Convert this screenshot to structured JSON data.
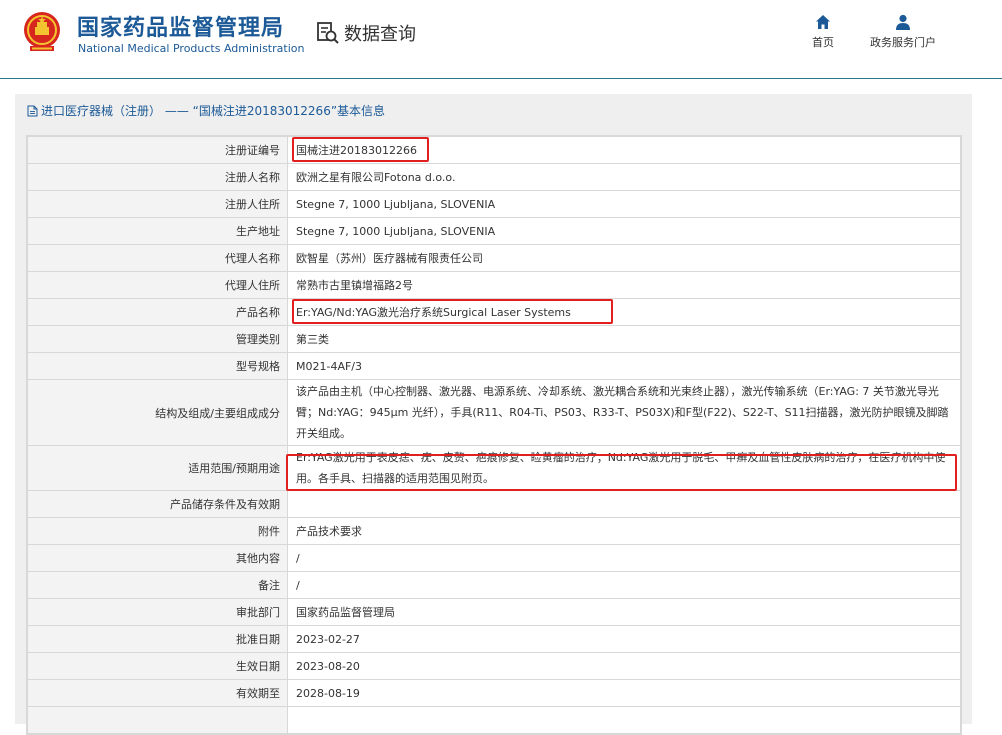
{
  "header": {
    "org_name_cn": "国家药品监督管理局",
    "org_name_en": "National Medical Products Administration",
    "search_label": "数据查询",
    "nav": [
      {
        "label": "首页",
        "icon": "home-icon"
      },
      {
        "label": "政务服务门户",
        "icon": "user-icon"
      }
    ]
  },
  "breadcrumb": "进口医疗器械（注册） —— “国械注进20183012266”基本信息",
  "rows": [
    {
      "label": "注册证编号",
      "value": "国械注进20183012266"
    },
    {
      "label": "注册人名称",
      "value": "欧洲之星有限公司Fotona d.o.o."
    },
    {
      "label": "注册人住所",
      "value": "Stegne 7, 1000 Ljubljana, SLOVENIA"
    },
    {
      "label": "生产地址",
      "value": "Stegne 7, 1000 Ljubljana, SLOVENIA"
    },
    {
      "label": "代理人名称",
      "value": "欧智星（苏州）医疗器械有限责任公司"
    },
    {
      "label": "代理人住所",
      "value": "常熟市古里镇增福路2号"
    },
    {
      "label": "产品名称",
      "value": "Er:YAG/Nd:YAG激光治疗系统Surgical Laser Systems"
    },
    {
      "label": "管理类别",
      "value": "第三类"
    },
    {
      "label": "型号规格",
      "value": "M021-4AF/3"
    },
    {
      "label": "结构及组成/主要组成成分",
      "value": "该产品由主机（中心控制器、激光器、电源系统、冷却系统、激光耦合系统和光束终止器），激光传输系统（Er:YAG: 7 关节激光导光臂；Nd:YAG：945μm 光纤），手具(R11、R04-Ti、PS03、R33-T、PS03X)和F型(F22)、S22-T、S11扫描器，激光防护眼镜及脚踏开关组成。"
    },
    {
      "label": "适用范围/预期用途",
      "value": "Er:YAG激光用于表皮痣、疣、皮赘、疤痕修复、睑黄瘤的治疗；Nd:YAG激光用于脱毛、甲癣及血管性皮肤病的治疗，在医疗机构中使用。各手具、扫描器的适用范围见附页。"
    },
    {
      "label": "产品储存条件及有效期",
      "value": ""
    },
    {
      "label": "附件",
      "value": "产品技术要求"
    },
    {
      "label": "其他内容",
      "value": "/"
    },
    {
      "label": "备注",
      "value": "/"
    },
    {
      "label": "审批部门",
      "value": "国家药品监督管理局"
    },
    {
      "label": "批准日期",
      "value": "2023-02-27"
    },
    {
      "label": "生效日期",
      "value": "2023-08-20"
    },
    {
      "label": "有效期至",
      "value": "2028-08-19"
    },
    {
      "label": "",
      "value": ""
    }
  ],
  "colors": {
    "brand_blue": "#1c5a97",
    "highlight_red": "#e02020",
    "panel_gray": "#efefef"
  }
}
